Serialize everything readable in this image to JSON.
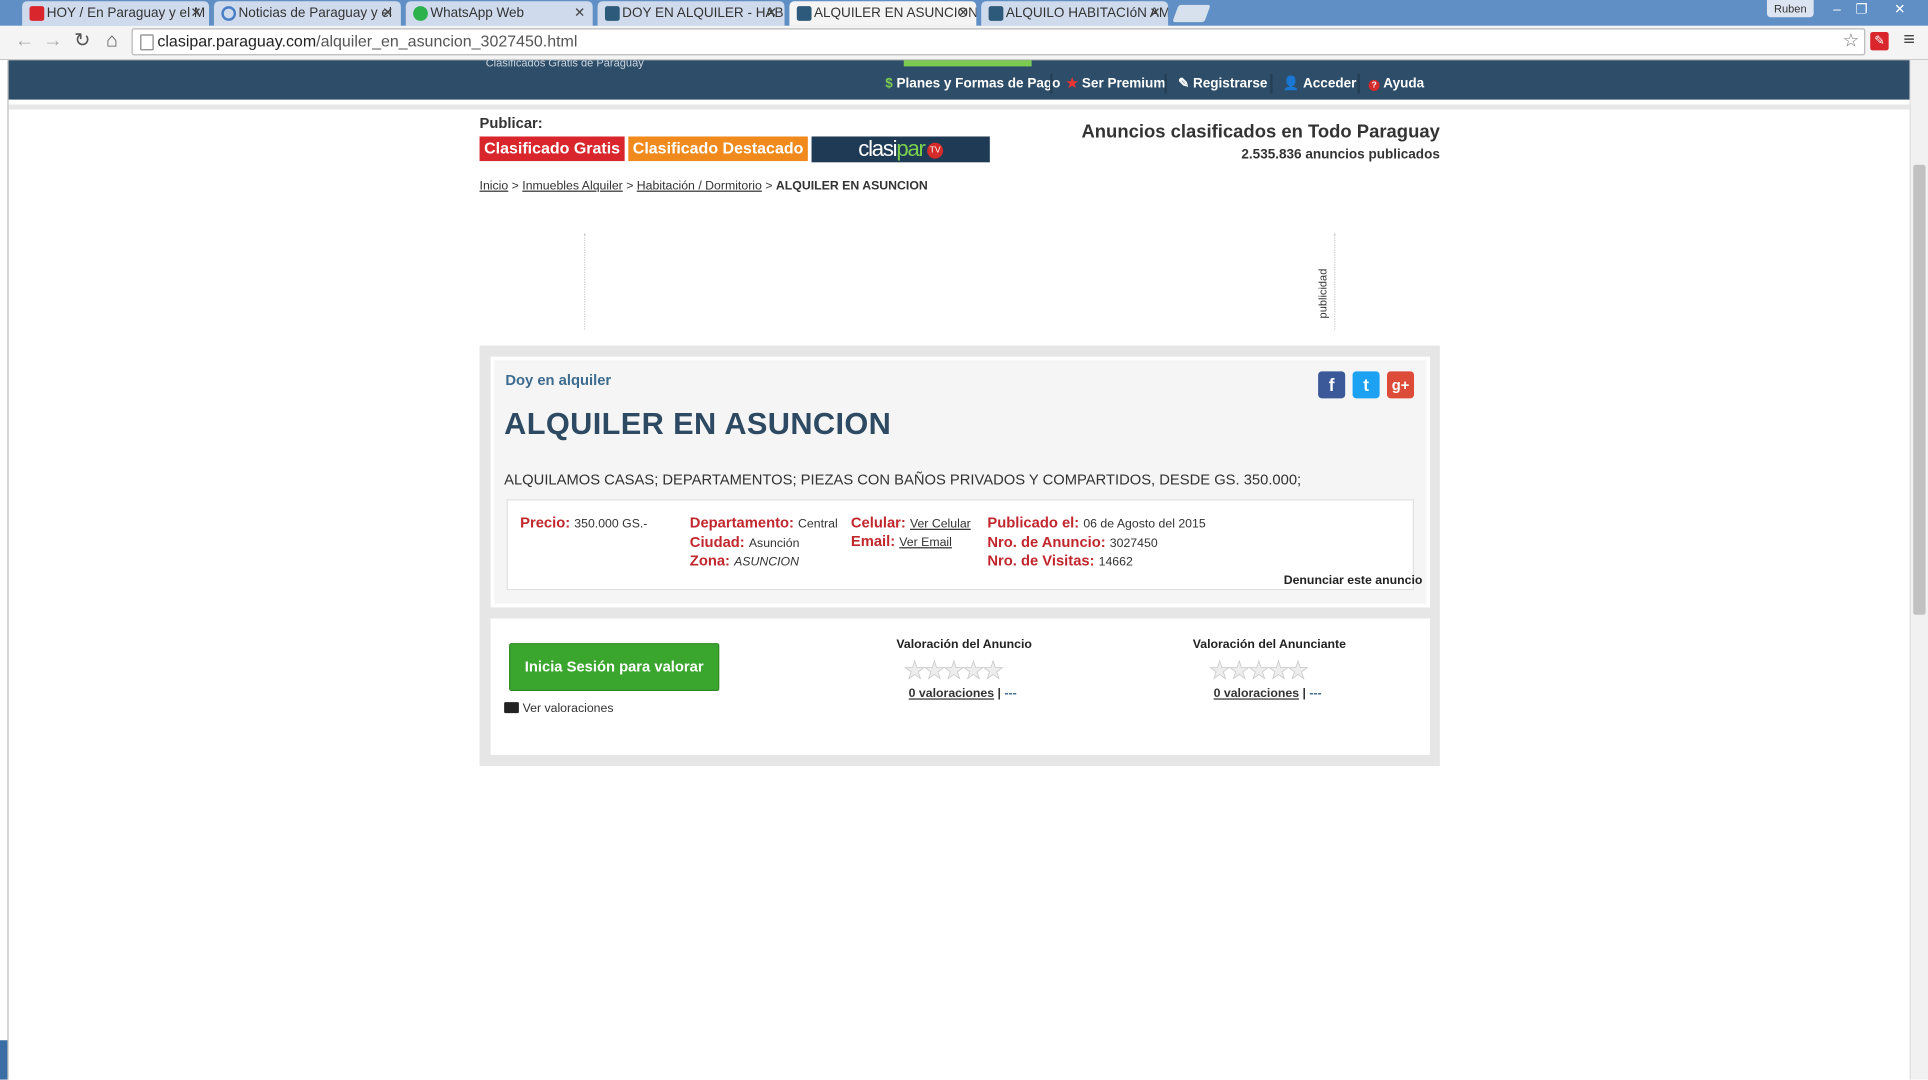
{
  "browser": {
    "tabs": [
      {
        "label": "HOY / En Paraguay y el M",
        "icon": "hoy-icon",
        "color": "#d9262c"
      },
      {
        "label": "Noticias de Paraguay y el",
        "icon": "loading-icon",
        "color": "#4a7fc8"
      },
      {
        "label": "WhatsApp Web",
        "icon": "whatsapp-icon",
        "color": "#2bb24c"
      },
      {
        "label": "DOY EN ALQUILER - HABI",
        "icon": "clasipar-icon",
        "color": "#2d5a7a"
      },
      {
        "label": "ALQUILER EN ASUNCION",
        "icon": "clasipar-icon",
        "color": "#2d5a7a",
        "active": true
      },
      {
        "label": "ALQUILO HABITACIóN AM",
        "icon": "clasipar-icon",
        "color": "#2d5a7a"
      }
    ],
    "profile": "Ruben",
    "url_host": "clasipar.paraguay.com",
    "url_path": "/alquiler_en_asuncion_3027450.html"
  },
  "site": {
    "slogan": "Clasificados Gratis de Paraguay",
    "nav": {
      "planes": "Planes y Formas de Pago",
      "premium": "Ser Premium",
      "registrarse": "Registrarse",
      "acceder": "Acceder",
      "ayuda": "Ayuda"
    },
    "publicar_label": "Publicar:",
    "btn_gratis": "Clasificado Gratis",
    "btn_destacado": "Clasificado Destacado",
    "tv_logo": {
      "a": "clasi",
      "b": "par",
      "tv": "TV"
    },
    "header_title": "Anuncios clasificados en Todo Paraguay",
    "header_count": "2.535.836 anuncios publicados",
    "colors": {
      "header_bg": "#2d4d68",
      "red": "#d9262c",
      "orange": "#f08a1c",
      "green": "#3aa62e",
      "label_red": "#c1272d"
    }
  },
  "breadcrumb": {
    "inicio": "Inicio",
    "inmuebles": "Inmuebles Alquiler",
    "habitacion": "Habitación / Dormitorio",
    "current": "ALQUILER EN ASUNCION",
    "sep": ">"
  },
  "ad": {
    "publicidad": "publicidad",
    "category": "Doy en alquiler",
    "title": "ALQUILER EN ASUNCION",
    "description": "ALQUILAMOS CASAS; DEPARTAMENTOS; PIEZAS CON BAÑOS PRIVADOS Y COMPARTIDOS, DESDE GS. 350.000;",
    "social": {
      "facebook": "f",
      "twitter": "t",
      "gplus": "g+"
    },
    "details": {
      "precio_label": "Precio:",
      "precio": "350.000 GS.-",
      "departamento_label": "Departamento:",
      "departamento": "Central",
      "ciudad_label": "Ciudad:",
      "ciudad": "Asunción",
      "zona_label": "Zona:",
      "zona": "ASUNCION",
      "celular_label": "Celular:",
      "celular": "Ver Celular",
      "email_label": "Email:",
      "email": "Ver Email",
      "publicado_label": "Publicado el:",
      "publicado": "06 de Agosto del 2015",
      "nro_anuncio_label": "Nro. de Anuncio:",
      "nro_anuncio": "3027450",
      "visitas_label": "Nro. de Visitas:",
      "visitas": "14662"
    },
    "denunciar": "Denunciar este anuncio"
  },
  "rating": {
    "login_button": "Inicia Sesión para valorar",
    "ver_valoraciones": "Ver valoraciones",
    "anuncio_title": "Valoración del Anuncio",
    "anunciante_title": "Valoración del Anunciante",
    "anuncio_count": "0 valoraciones",
    "anunciante_count": "0 valoraciones",
    "dash": "---",
    "stars_filled": 0,
    "stars_total": 5
  }
}
